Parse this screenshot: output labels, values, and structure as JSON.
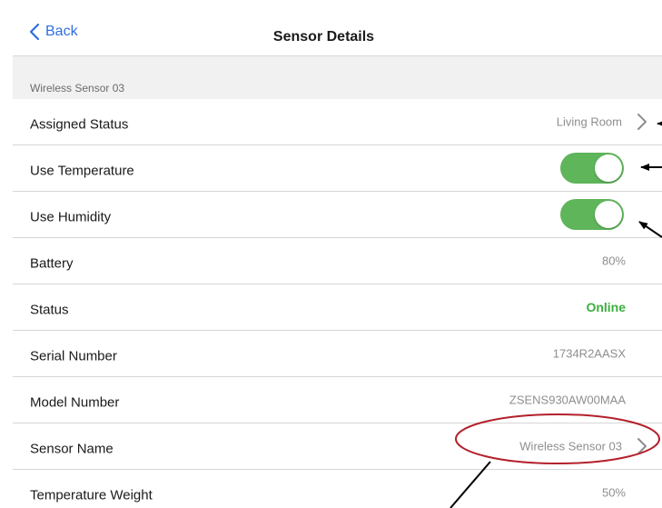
{
  "navbar": {
    "back_label": "Back",
    "title": "Sensor Details"
  },
  "section": {
    "header": "Wireless Sensor 03"
  },
  "rows": [
    {
      "label": "Assigned Status",
      "value": "Living Room",
      "kind": "link"
    },
    {
      "label": "Use Temperature",
      "kind": "toggle",
      "on": true
    },
    {
      "label": "Use Humidity",
      "kind": "toggle",
      "on": true
    },
    {
      "label": "Battery",
      "value": "80%",
      "kind": "value"
    },
    {
      "label": "Status",
      "value": "Online",
      "kind": "status"
    },
    {
      "label": "Serial Number",
      "value": "1734R2AASX",
      "kind": "value"
    },
    {
      "label": "Model Number",
      "value": "ZSENS930AW00MAA",
      "kind": "value"
    },
    {
      "label": "Sensor Name",
      "value": "Wireless Sensor 03",
      "kind": "link"
    },
    {
      "label": "Temperature Weight",
      "value": "50%",
      "kind": "value"
    }
  ],
  "icons": {
    "back": "chevron-left-icon",
    "disclosure": "chevron-right-icon"
  },
  "colors": {
    "accent": "#2f6ee0",
    "toggle_on": "#5fb55a",
    "status_online": "#3bb03b",
    "annotation_ring": "#b3202a"
  }
}
